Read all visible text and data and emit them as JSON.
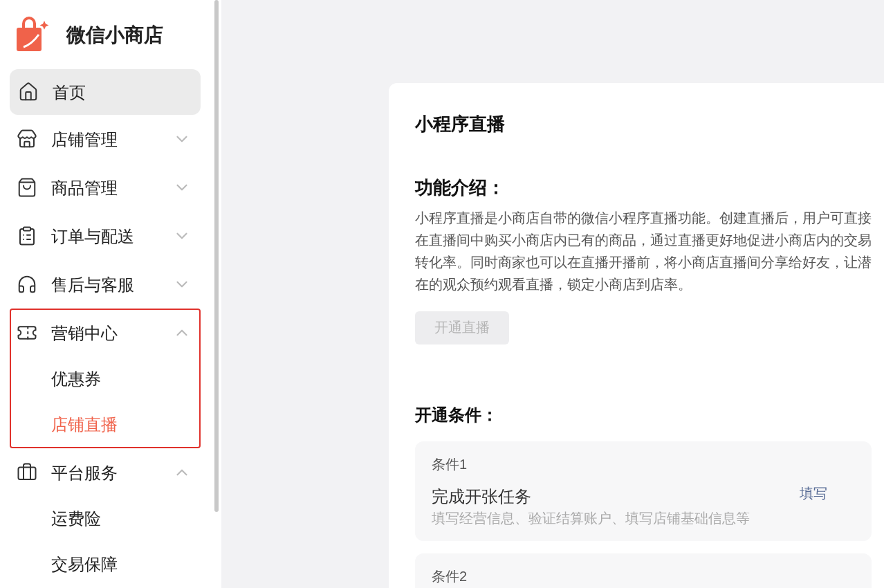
{
  "brand": {
    "name": "微信小商店"
  },
  "sidebar": {
    "items": [
      {
        "kind": "item",
        "label": "首页",
        "selected": true
      },
      {
        "kind": "group",
        "label": "店铺管理",
        "expanded": false,
        "highlighted": false
      },
      {
        "kind": "group",
        "label": "商品管理",
        "expanded": false,
        "highlighted": false
      },
      {
        "kind": "group",
        "label": "订单与配送",
        "expanded": false,
        "highlighted": false
      },
      {
        "kind": "group",
        "label": "售后与客服",
        "expanded": false,
        "highlighted": false
      },
      {
        "kind": "group",
        "label": "营销中心",
        "expanded": true,
        "highlighted": true,
        "children": [
          {
            "label": "优惠券",
            "selected": false
          },
          {
            "label": "店铺直播",
            "selected": true
          }
        ]
      },
      {
        "kind": "group",
        "label": "平台服务",
        "expanded": true,
        "highlighted": false,
        "children": [
          {
            "label": "运费险",
            "selected": false
          },
          {
            "label": "交易保障",
            "selected": false
          }
        ]
      }
    ]
  },
  "panel": {
    "title": "小程序直播",
    "intro_heading": "功能介绍：",
    "intro_text": "小程序直播是小商店自带的微信小程序直播功能。创建直播后，用户可直接在直播间中购买小商店内已有的商品，通过直播更好地促进小商店内的交易转化率。同时商家也可以在直播开播前，将小商店直播间分享给好友，让潜在的观众预约观看直播，锁定小商店到店率。",
    "button": {
      "label": "开通直播",
      "disabled": true
    },
    "conditions_heading": "开通条件：",
    "conditions": [
      {
        "label": "条件1",
        "title": "完成开张任务",
        "description": "填写经营信息、验证结算账户、填写店铺基础信息等",
        "action": "填写"
      },
      {
        "label": "条件2"
      }
    ]
  }
}
